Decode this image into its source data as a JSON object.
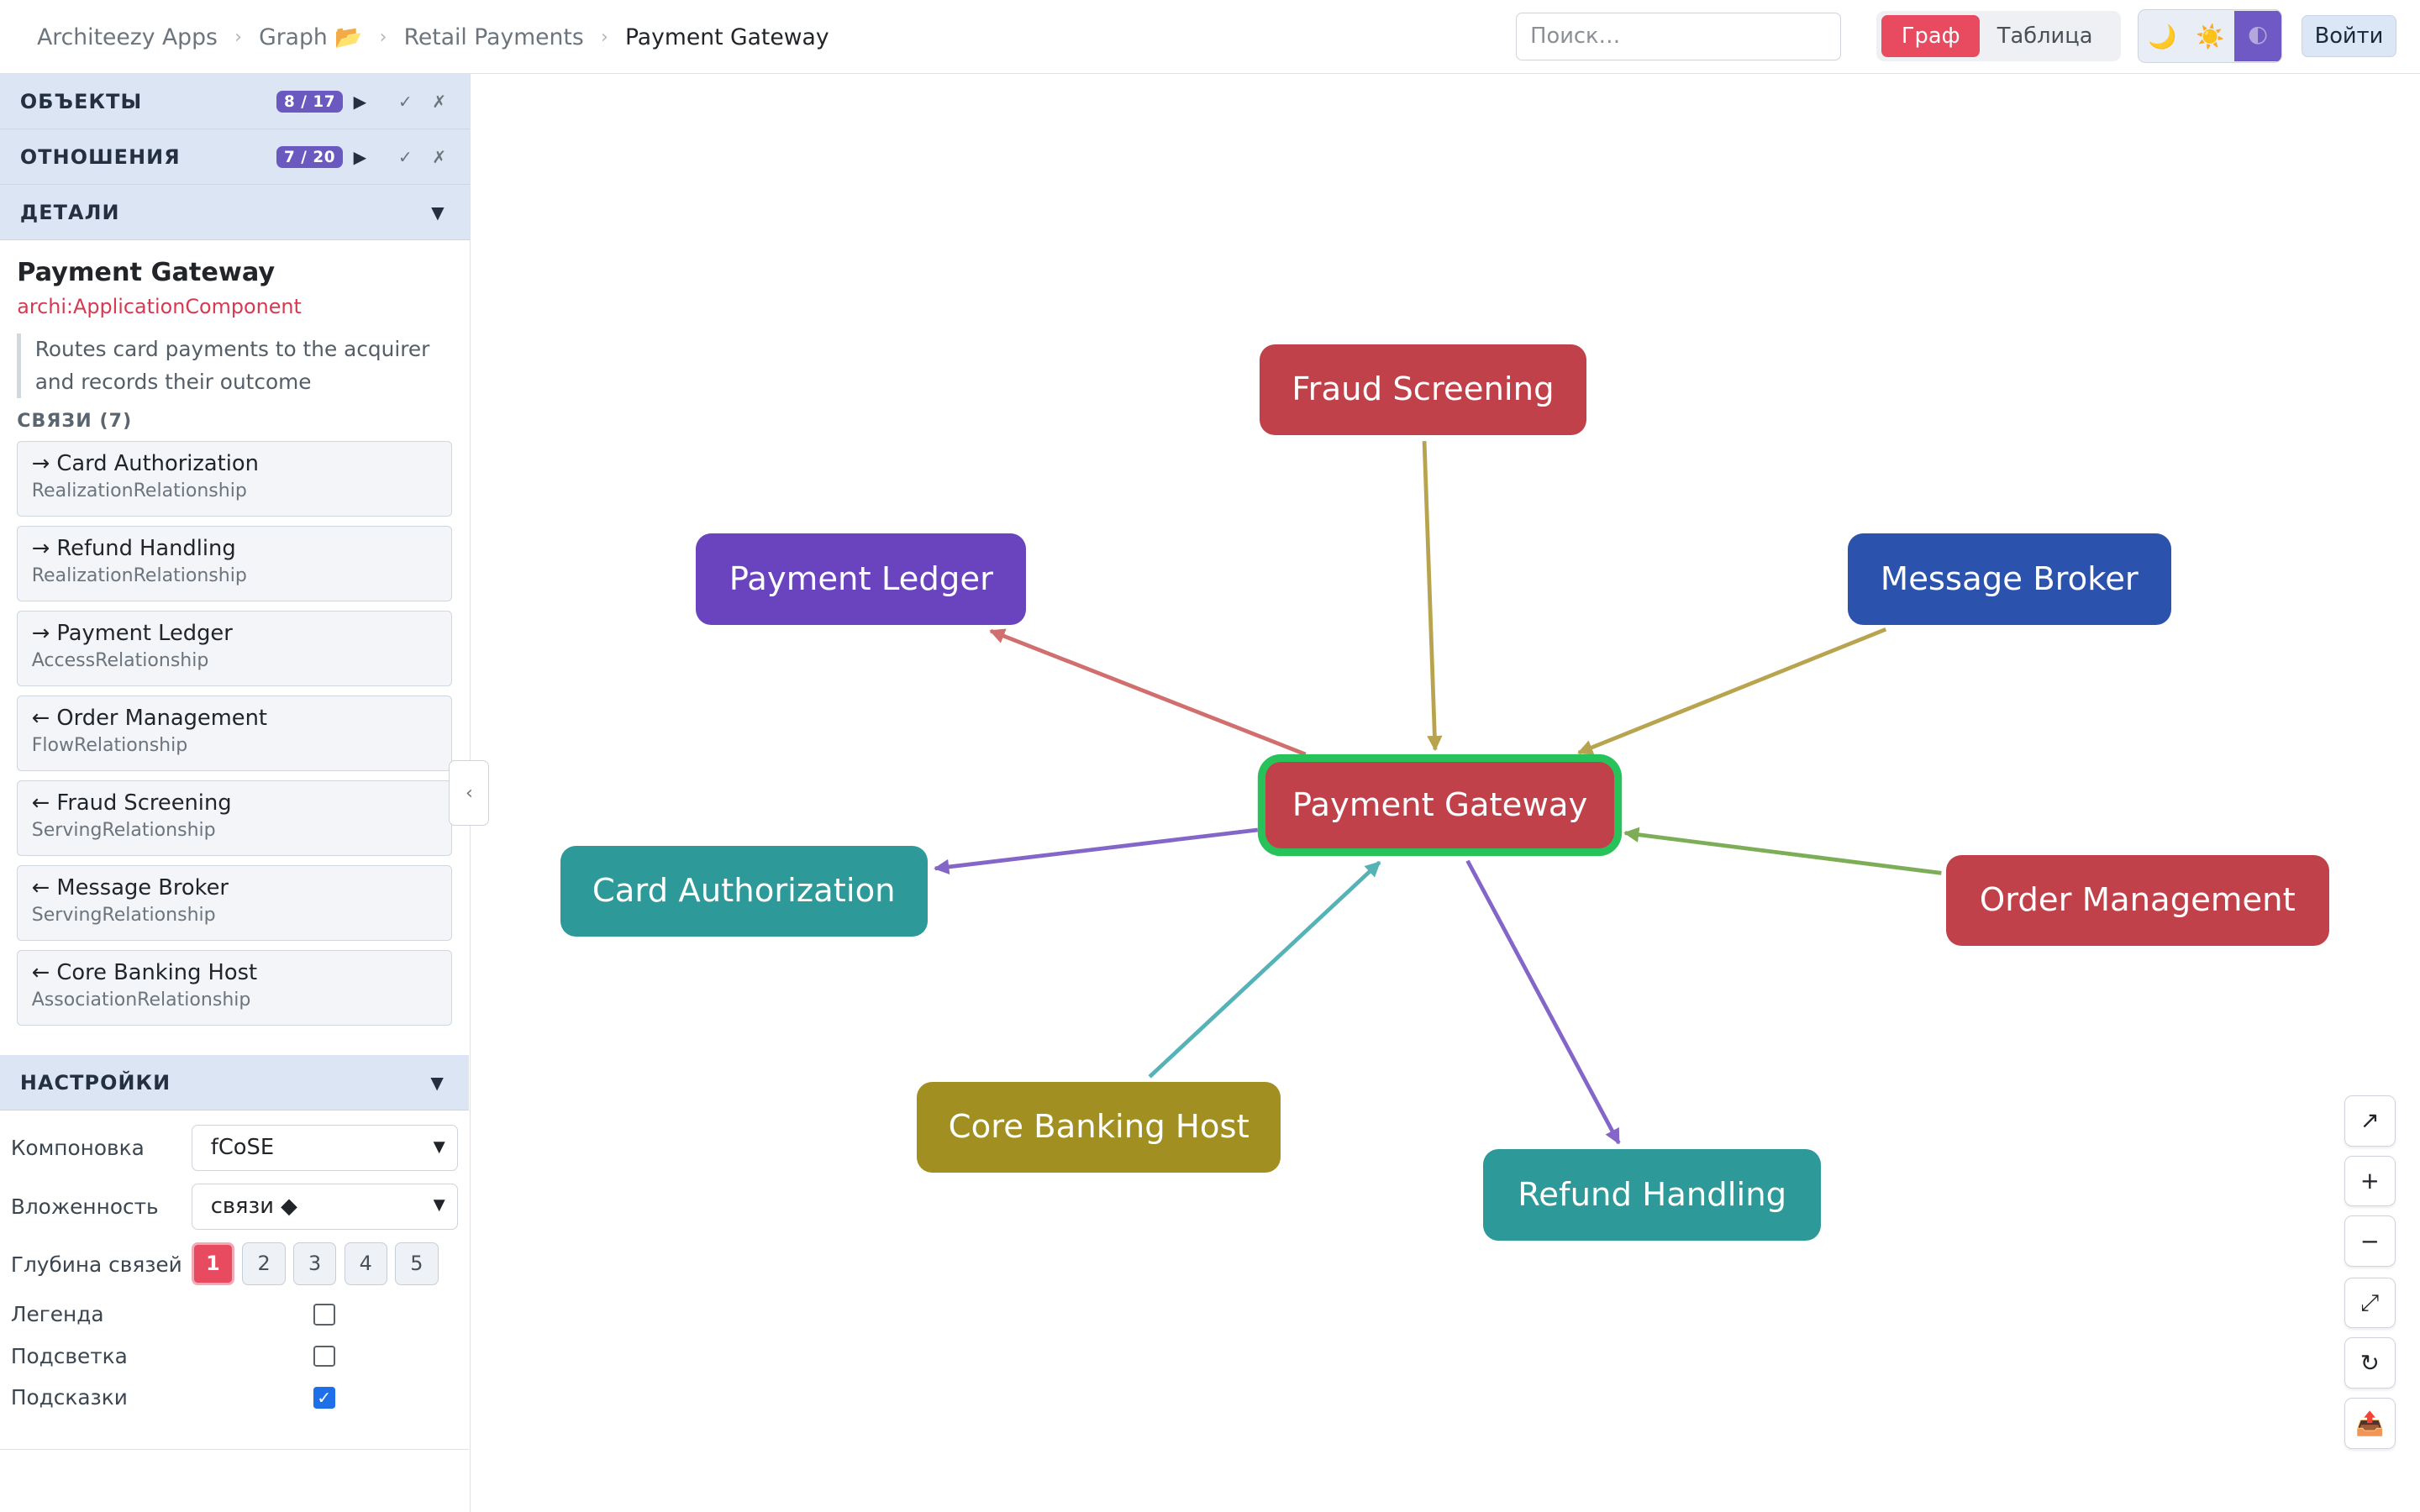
{
  "breadcrumb": {
    "items": [
      "Architeezy Apps",
      "Graph 📂",
      "Retail Payments",
      "Payment Gateway"
    ]
  },
  "search": {
    "placeholder": "Поиск…"
  },
  "view_toggle": {
    "graph": "Граф",
    "table": "Таблица"
  },
  "theme": {
    "dark_icon": "🌙",
    "light_icon": "☀️",
    "system_icon": "🌓"
  },
  "login_label": "Войти",
  "sidebar": {
    "objects": {
      "title": "ОБЪЕКТЫ",
      "badge": "8 / 17"
    },
    "relations": {
      "title": "ОТНОШЕНИЯ",
      "badge": "7 / 20"
    },
    "details_title": "ДЕТАЛИ",
    "settings_title": "НАСТРОЙКИ",
    "icons": {
      "expand": "▶",
      "collapse": "▼",
      "check": "✓",
      "cross": "✗",
      "sidebar_toggle": "‹"
    }
  },
  "details": {
    "name": "Payment Gateway",
    "type": "archi:ApplicationComponent",
    "description": "Routes card payments to the acquirer and records their outcome",
    "links_title": "СВЯЗИ (7)",
    "links": [
      {
        "name": "→ Card Authorization",
        "type": "RealizationRelationship"
      },
      {
        "name": "→ Refund Handling",
        "type": "RealizationRelationship"
      },
      {
        "name": "→ Payment Ledger",
        "type": "AccessRelationship"
      },
      {
        "name": "← Order Management",
        "type": "FlowRelationship"
      },
      {
        "name": "← Fraud Screening",
        "type": "ServingRelationship"
      },
      {
        "name": "← Message Broker",
        "type": "ServingRelationship"
      },
      {
        "name": "← Core Banking Host",
        "type": "AssociationRelationship"
      }
    ]
  },
  "settings": {
    "layout_label": "Компоновка",
    "layout_value": "fCoSE",
    "nesting_label": "Вложенность",
    "nesting_value": "связи ◆",
    "depth_label": "Глубина связей",
    "depth_options": [
      "1",
      "2",
      "3",
      "4",
      "5"
    ],
    "depth_selected": "1",
    "legend_label": "Легенда",
    "legend_checked": false,
    "highlight_label": "Подсветка",
    "highlight_checked": false,
    "tooltips_label": "Подсказки",
    "tooltips_checked": true
  },
  "graph": {
    "nodes": {
      "fraud": {
        "label": "Fraud Screening",
        "color": "#c0414a"
      },
      "ledger": {
        "label": "Payment Ledger",
        "color": "#6a44be"
      },
      "broker": {
        "label": "Message Broker",
        "color": "#2b52ac"
      },
      "gateway": {
        "label": "Payment Gateway",
        "color": "#c0414a"
      },
      "card": {
        "label": "Card Authorization",
        "color": "#2d9a99"
      },
      "order": {
        "label": "Order Management",
        "color": "#c0414a"
      },
      "core": {
        "label": "Core Banking Host",
        "color": "#a18f22"
      },
      "refund": {
        "label": "Refund Handling",
        "color": "#2d9a99"
      }
    },
    "selected_outline": "#27c35a",
    "edge_colors": {
      "serving": "#b8a44f",
      "access": "#d16f6f",
      "realization": "#8466c9",
      "flow": "#7dae57",
      "association": "#55b3b8"
    }
  },
  "controls": {
    "fit_icon": "↗",
    "zoom_in_icon": "+",
    "zoom_out_icon": "−",
    "fullscreen_icon": "⤢",
    "reset_icon": "↻",
    "export_icon": "📤"
  }
}
